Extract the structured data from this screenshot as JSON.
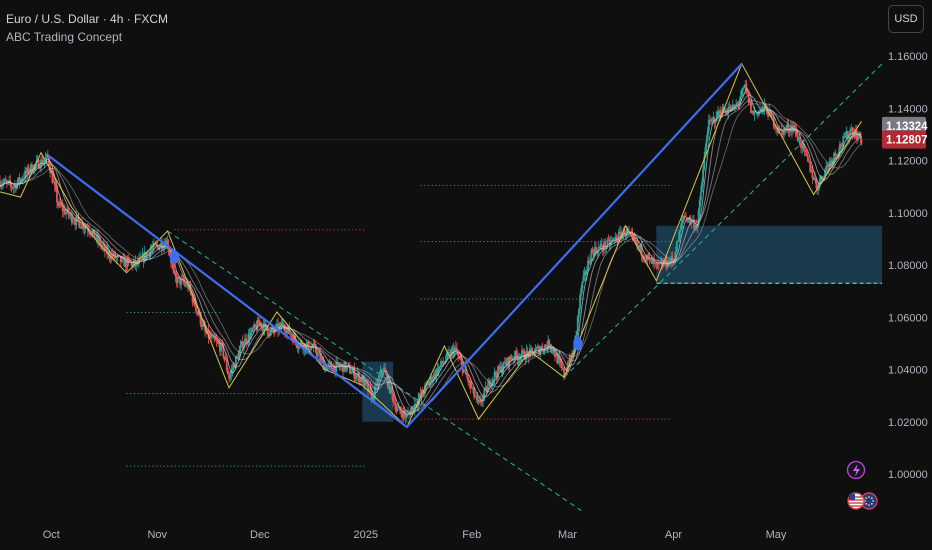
{
  "header": {
    "symbol_line": "Euro / U.S. Dollar · 4h · FXCM",
    "indicator": "ABC Trading Concept",
    "currency_button": "USD"
  },
  "colors": {
    "background": "#0f0f0f",
    "abc_line": "#3d6ef0",
    "zigzag": "#d8c24a",
    "ribbon": "#c9c9d6",
    "candle_up": "#26a69a",
    "candle_down": "#ef5350",
    "box_fill": "#1e4a63",
    "target_line": "#26a69a",
    "resistance_line": "#c04050",
    "price_badge": "#b22833",
    "alt_badge": "#787b86"
  },
  "badges": {
    "current_price": "1.12807",
    "alt_price": "1.13324"
  },
  "icons": [
    "lightning-icon",
    "us-flag-icon",
    "eu-flag-icon"
  ],
  "chart_data": {
    "type": "line",
    "title": "Euro / U.S. Dollar · 4h · FXCM",
    "xlabel": "",
    "ylabel": "",
    "ylim": [
      0.99,
      1.17
    ],
    "grid": false,
    "x_ticks": [
      "Oct",
      "Nov",
      "Dec",
      "2025",
      "Feb",
      "Mar",
      "Apr",
      "May"
    ],
    "y_ticks": [
      "1.00000",
      "1.02000",
      "1.04000",
      "1.06000",
      "1.08000",
      "1.10000",
      "1.12000",
      "1.14000",
      "1.16000"
    ],
    "y_tick_values": [
      1.0,
      1.02,
      1.04,
      1.06,
      1.08,
      1.1,
      1.12,
      1.14,
      1.16
    ],
    "series": [
      {
        "role": "price",
        "points": [
          [
            "2024-09-16",
            1.112
          ],
          [
            "2024-09-20",
            1.11
          ],
          [
            "2024-09-25",
            1.117
          ],
          [
            "2024-09-30",
            1.121
          ],
          [
            "2024-10-03",
            1.103
          ],
          [
            "2024-10-08",
            1.097
          ],
          [
            "2024-10-12",
            1.094
          ],
          [
            "2024-10-17",
            1.085
          ],
          [
            "2024-10-22",
            1.081
          ],
          [
            "2024-10-26",
            1.08
          ],
          [
            "2024-10-30",
            1.086
          ],
          [
            "2024-11-04",
            1.089
          ],
          [
            "2024-11-06",
            1.075
          ],
          [
            "2024-11-10",
            1.072
          ],
          [
            "2024-11-15",
            1.054
          ],
          [
            "2024-11-20",
            1.048
          ],
          [
            "2024-11-22",
            1.037
          ],
          [
            "2024-11-26",
            1.05
          ],
          [
            "2024-12-01",
            1.058
          ],
          [
            "2024-12-04",
            1.054
          ],
          [
            "2024-12-08",
            1.057
          ],
          [
            "2024-12-12",
            1.05
          ],
          [
            "2024-12-17",
            1.048
          ],
          [
            "2024-12-20",
            1.041
          ],
          [
            "2024-12-26",
            1.041
          ],
          [
            "2024-12-31",
            1.036
          ],
          [
            "2025-01-03",
            1.029
          ],
          [
            "2025-01-06",
            1.041
          ],
          [
            "2025-01-10",
            1.025
          ],
          [
            "2025-01-13",
            1.022
          ],
          [
            "2025-01-17",
            1.03
          ],
          [
            "2025-01-22",
            1.04
          ],
          [
            "2025-01-27",
            1.048
          ],
          [
            "2025-02-03",
            1.026
          ],
          [
            "2025-02-07",
            1.037
          ],
          [
            "2025-02-13",
            1.045
          ],
          [
            "2025-02-18",
            1.046
          ],
          [
            "2025-02-24",
            1.05
          ],
          [
            "2025-02-28",
            1.038
          ],
          [
            "2025-03-03",
            1.048
          ],
          [
            "2025-03-05",
            1.071
          ],
          [
            "2025-03-08",
            1.085
          ],
          [
            "2025-03-13",
            1.088
          ],
          [
            "2025-03-18",
            1.093
          ],
          [
            "2025-03-24",
            1.083
          ],
          [
            "2025-03-27",
            1.079
          ],
          [
            "2025-04-01",
            1.082
          ],
          [
            "2025-04-04",
            1.099
          ],
          [
            "2025-04-08",
            1.095
          ],
          [
            "2025-04-11",
            1.133
          ],
          [
            "2025-04-15",
            1.139
          ],
          [
            "2025-04-19",
            1.14
          ],
          [
            "2025-04-22",
            1.148
          ],
          [
            "2025-04-24",
            1.138
          ],
          [
            "2025-04-28",
            1.14
          ],
          [
            "2025-05-02",
            1.131
          ],
          [
            "2025-05-06",
            1.133
          ],
          [
            "2025-05-09",
            1.124
          ],
          [
            "2025-05-13",
            1.11
          ],
          [
            "2025-05-16",
            1.118
          ],
          [
            "2025-05-20",
            1.126
          ],
          [
            "2025-05-23",
            1.132
          ],
          [
            "2025-05-26",
            1.128
          ]
        ]
      },
      {
        "role": "abc_projection",
        "points": [
          [
            "2024-09-30",
            1.122
          ],
          [
            "2025-01-13",
            1.018
          ],
          [
            "2025-04-21",
            1.157
          ]
        ]
      },
      {
        "role": "zigzag",
        "points": [
          [
            "2024-09-16",
            1.108
          ],
          [
            "2024-09-22",
            1.106
          ],
          [
            "2024-09-28",
            1.123
          ],
          [
            "2024-10-07",
            1.102
          ],
          [
            "2024-10-15",
            1.088
          ],
          [
            "2024-10-23",
            1.077
          ],
          [
            "2024-11-04",
            1.093
          ],
          [
            "2024-11-22",
            1.033
          ],
          [
            "2024-12-06",
            1.062
          ],
          [
            "2024-12-20",
            1.04
          ],
          [
            "2024-12-31",
            1.034
          ],
          [
            "2025-01-13",
            1.018
          ],
          [
            "2025-01-24",
            1.049
          ],
          [
            "2025-02-03",
            1.021
          ],
          [
            "2025-02-18",
            1.047
          ],
          [
            "2025-02-28",
            1.037
          ],
          [
            "2025-03-18",
            1.095
          ],
          [
            "2025-03-27",
            1.074
          ],
          [
            "2025-04-21",
            1.157
          ],
          [
            "2025-05-12",
            1.107
          ],
          [
            "2025-05-26",
            1.135
          ]
        ]
      }
    ],
    "annotations": {
      "dashed_trendlines": [
        [
          [
            "2024-11-04",
            1.093
          ],
          [
            "2025-03-05",
            0.986
          ]
        ],
        [
          [
            "2025-02-28",
            1.037
          ],
          [
            "2025-06-01",
            1.157
          ]
        ]
      ],
      "dotted_levels": [
        {
          "y": 1.0935,
          "from": "2024-11-06",
          "to": "2025-01-01",
          "color": "resistance_line"
        },
        {
          "y": 1.0618,
          "from": "2024-10-23",
          "to": "2024-11-20",
          "color": "target_line"
        },
        {
          "y": 1.0308,
          "from": "2024-10-23",
          "to": "2025-01-01",
          "color": "target_line"
        },
        {
          "y": 1.003,
          "from": "2024-10-23",
          "to": "2025-01-01",
          "color": "target_line"
        },
        {
          "y": 1.1105,
          "from": "2025-01-17",
          "to": "2025-03-31",
          "color": "target_line"
        },
        {
          "y": 1.089,
          "from": "2025-01-17",
          "to": "2025-03-31",
          "color": "target_line"
        },
        {
          "y": 1.067,
          "from": "2025-01-17",
          "to": "2025-03-06",
          "color": "target_line"
        },
        {
          "y": 1.021,
          "from": "2025-01-17",
          "to": "2025-03-31",
          "color": "resistance_line"
        },
        {
          "y": 1.073,
          "from": "2025-03-27",
          "to": "2025-06-01",
          "color": "target_line"
        }
      ],
      "boxes": [
        {
          "from": "2024-12-31",
          "to": "2025-01-09",
          "y0": 1.02,
          "y1": 1.043
        },
        {
          "from": "2025-03-27",
          "to": "2025-06-01",
          "y0": 1.073,
          "y1": 1.095
        }
      ],
      "signal_markers": [
        [
          "2024-11-06",
          1.083
        ],
        [
          "2025-03-04",
          1.05
        ]
      ]
    }
  }
}
